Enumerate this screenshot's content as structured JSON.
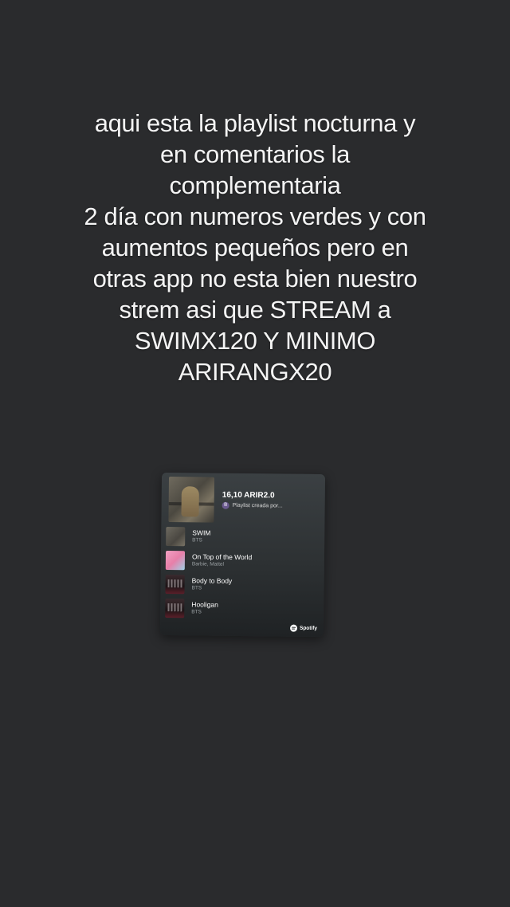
{
  "caption": {
    "lines": [
      "aqui esta la playlist nocturna y",
      "en comentarios la",
      "complementaria",
      "2 día con numeros verdes y con",
      "aumentos pequeños pero en",
      "otras app no esta bien nuestro",
      "strem asi que STREAM a",
      "SWIMX120 Y MINIMO",
      "ARIRANGX20"
    ]
  },
  "playlist_card": {
    "title": "16,10 ARIR2.0",
    "subtitle": "Playlist creada por...",
    "owner_avatar_letter": "B",
    "tracks": [
      {
        "name": "SWIM",
        "artist": "BTS",
        "cover": "swim-cover"
      },
      {
        "name": "On Top of the World",
        "artist": "Barbie, Mattel",
        "cover": "barbie-cover"
      },
      {
        "name": "Body to Body",
        "artist": "BTS",
        "cover": "bts-cover"
      },
      {
        "name": "Hooligan",
        "artist": "BTS",
        "cover": "bts-cover"
      }
    ],
    "brand_label": "Spotify"
  },
  "colors": {
    "background": "#2a2b2d",
    "caption_text": "#f4f4f4",
    "card_top": "#3b4043",
    "card_bottom": "#1f2224"
  }
}
